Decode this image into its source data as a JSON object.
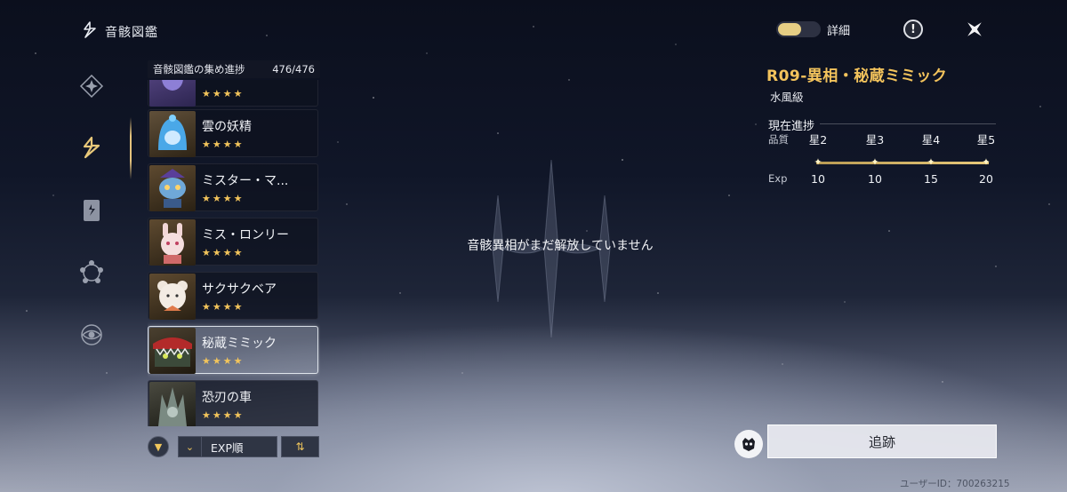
{
  "header": {
    "title": "音骸図鑑"
  },
  "nav": {
    "items": [
      {
        "name": "nav-echo-core",
        "icon": "diamond-star-icon"
      },
      {
        "name": "nav-echo-catalog",
        "icon": "echo-bookmark-icon",
        "selected": true
      },
      {
        "name": "nav-card",
        "icon": "card-icon"
      },
      {
        "name": "nav-pentagon",
        "icon": "pentagon-nodes-icon"
      },
      {
        "name": "nav-eye",
        "icon": "eye-ring-icon"
      }
    ]
  },
  "collection": {
    "label": "音骸図鑑の集め進捗",
    "value": "476/476"
  },
  "list": {
    "items": [
      {
        "name": "",
        "stars": "★★★★",
        "partial": true
      },
      {
        "name": "雲の妖精",
        "stars": "★★★★"
      },
      {
        "name": "ミスター・マ...",
        "stars": "★★★★"
      },
      {
        "name": "ミス・ロンリー",
        "stars": "★★★★"
      },
      {
        "name": "サクサクベア",
        "stars": "★★★★"
      },
      {
        "name": "秘蔵ミミック",
        "stars": "★★★★",
        "selected": true
      },
      {
        "name": "恐刃の車",
        "stars": "★★★★"
      }
    ]
  },
  "controls": {
    "sort_label": "EXP順",
    "order_icon": "⇅",
    "filter_icon": "filter-icon"
  },
  "center": {
    "message": "音骸異相がまだ解放していません"
  },
  "detail": {
    "toggle_label": "詳細",
    "echo_name": "R09-異相・秘蔵ミミック",
    "echo_class": "水風級",
    "progress_title": "現在進捗",
    "quality_label": "品質",
    "exp_label": "Exp",
    "levels": [
      "星2",
      "星3",
      "星4",
      "星5"
    ],
    "exp_values": [
      "10",
      "10",
      "15",
      "20"
    ]
  },
  "track": {
    "label": "追跡"
  },
  "user": {
    "id_text": "ユーザーID：700263215"
  },
  "colors": {
    "accent_gold": "#f3c35c",
    "star": "#f2c45b"
  }
}
